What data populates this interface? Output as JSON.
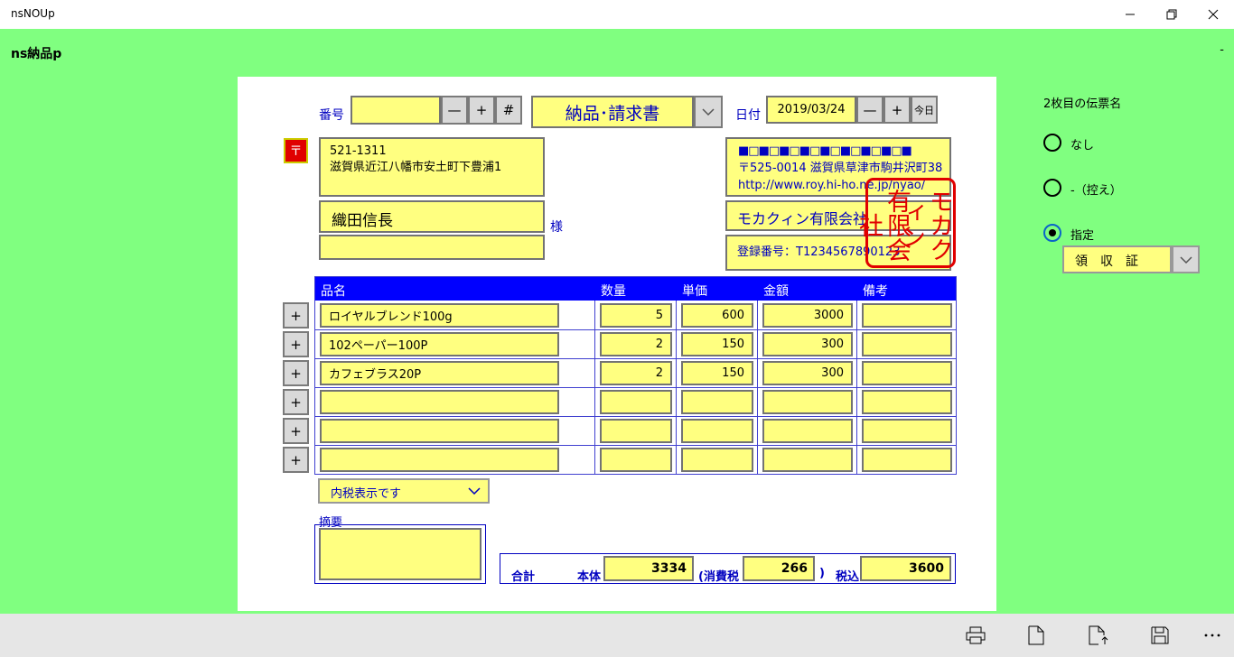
{
  "window": {
    "title": "nsNOUp",
    "minimize_icon": "minimize-icon",
    "restore_icon": "restore-icon",
    "close_icon": "close-icon"
  },
  "app": {
    "title": "ns納品p",
    "dash": "-"
  },
  "form": {
    "number_label": "番号",
    "number_value": "",
    "minus_label": "—",
    "plus_label": "+",
    "hash_label": "#",
    "doctype_value": "納品･請求書",
    "date_label": "日付",
    "date_value": "2019/03/24",
    "today_label": "今日",
    "postal_mark": "〒",
    "customer_address": [
      "521-1311",
      "滋賀県近江八幡市安土町下豊浦1"
    ],
    "customer_name": "織田信長",
    "customer_extra": "",
    "honorific": "様",
    "company_address": [
      "■□■□■□■□■□■□■□■□■",
      "〒525-0014 滋賀県草津市駒井沢町38",
      "http://www.roy.hi-ho.ne.jp/nyao/"
    ],
    "company_name": "モカクィン有限会社",
    "registration": "登録番号：T1234567890123",
    "seal_text": [
      "モカクィン",
      "有限会社"
    ]
  },
  "table": {
    "headers": [
      "品名",
      "数量",
      "単価",
      "金額",
      "備考"
    ],
    "add_label": "+",
    "rows": [
      {
        "name": "ロイヤルブレンド100g",
        "qty": "5",
        "price": "600",
        "amount": "3000",
        "note": ""
      },
      {
        "name": "102ペーパー100P",
        "qty": "2",
        "price": "150",
        "amount": "300",
        "note": ""
      },
      {
        "name": "カフェブラス20P",
        "qty": "2",
        "price": "150",
        "amount": "300",
        "note": ""
      },
      {
        "name": "",
        "qty": "",
        "price": "",
        "amount": "",
        "note": ""
      },
      {
        "name": "",
        "qty": "",
        "price": "",
        "amount": "",
        "note": ""
      },
      {
        "name": "",
        "qty": "",
        "price": "",
        "amount": "",
        "note": ""
      }
    ]
  },
  "tax_mode": "内税表示です",
  "summary": {
    "label": "摘要",
    "value": ""
  },
  "totals": {
    "label": "合計",
    "base_label": "本体",
    "base": "3334",
    "tax_label": "(消費税",
    "tax": "266",
    "close_paren": ")",
    "incl_label": "税込",
    "incl": "3600"
  },
  "side": {
    "title": "2枚目の伝票名",
    "options": [
      "なし",
      "-（控え）",
      "指定"
    ],
    "selected": "指定",
    "custom_value": "領　収　証"
  },
  "commands": [
    "printer-icon",
    "new-document-icon",
    "export-document-icon",
    "save-icon",
    "more-icon"
  ],
  "colors": {
    "background": "#80ff80",
    "field": "#ffff80",
    "accent_blue": "#0000ff",
    "seal_red": "#e00000"
  }
}
